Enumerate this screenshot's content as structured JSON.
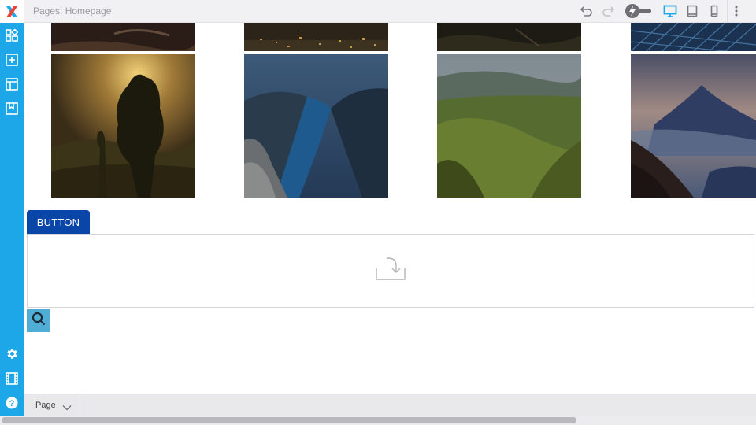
{
  "topbar": {
    "page_label": "Pages: Homepage",
    "undo_icon": "undo-icon",
    "redo_icon": "redo-icon",
    "lightning_toggle_icon": "lightning-toggle-icon",
    "device_icons": [
      "desktop-icon",
      "tablet-icon",
      "mobile-icon"
    ],
    "more_icon": "more-vertical-icon"
  },
  "sidebar": {
    "logo_icon": "app-logo-icon",
    "top_items": [
      "widgets-icon",
      "add-section-icon",
      "layout-icon",
      "saved-blocks-icon"
    ],
    "bottom_items": [
      "settings-icon",
      "media-icon",
      "help-icon"
    ],
    "help_glyph": "?"
  },
  "canvas": {
    "button_label": "BUTTON",
    "dropzone_icon": "download-icon",
    "search_icon": "search-icon",
    "images": [
      "forest-sunrise",
      "fjord-river",
      "green-valley",
      "mountain-sunset"
    ]
  },
  "bottombar": {
    "page_select_label": "Page",
    "page_select_icon": "chevron-down-icon"
  },
  "colors": {
    "sidebar": "#1ea7e8",
    "button": "#0a45a8",
    "search_button": "#50aed6",
    "active_device": "#1ea7e8"
  }
}
